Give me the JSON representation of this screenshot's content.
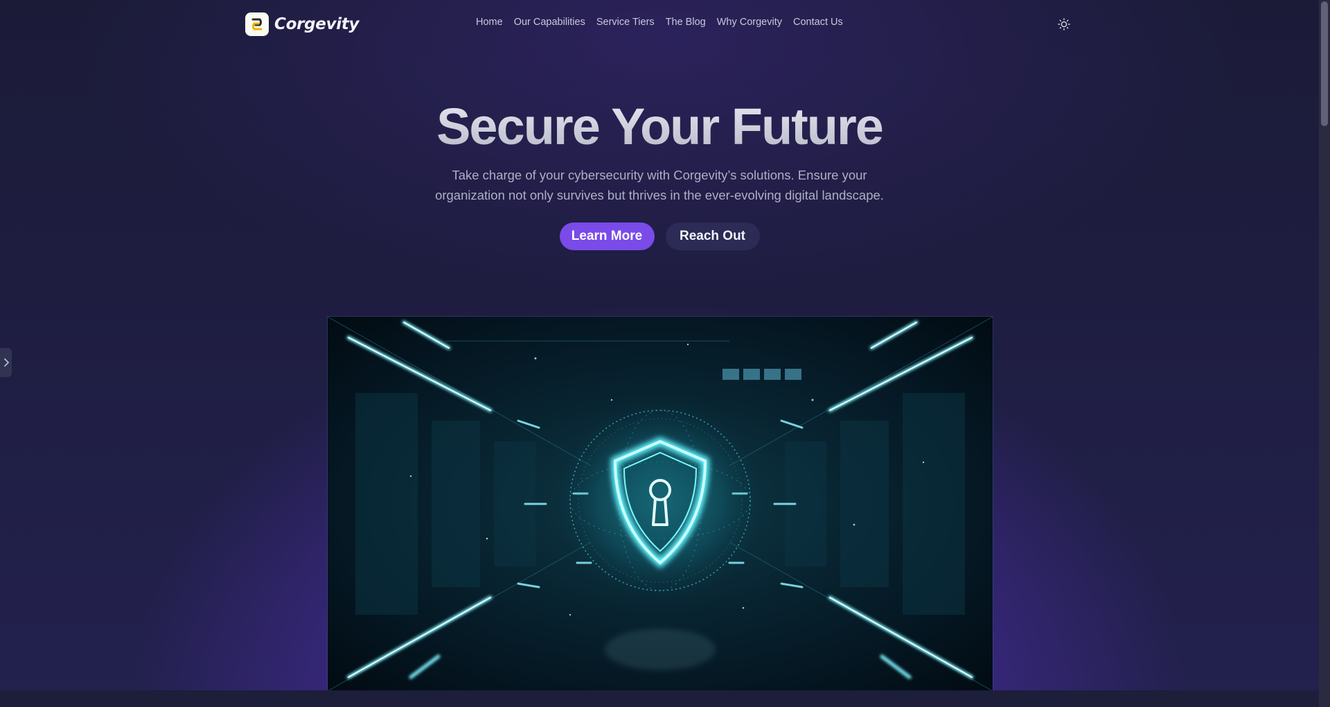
{
  "brand": {
    "name": "Corgevity",
    "logo_icon": "corgevity-logo-icon"
  },
  "nav": {
    "items": [
      {
        "label": "Home"
      },
      {
        "label": "Our Capabilities"
      },
      {
        "label": "Service Tiers"
      },
      {
        "label": "The Blog"
      },
      {
        "label": "Why Corgevity"
      },
      {
        "label": "Contact Us"
      }
    ],
    "theme_toggle_icon": "sun-icon"
  },
  "hero": {
    "title": "Secure Your Future",
    "subtitle": "Take charge of your cybersecurity with Corgevity’s solutions. Ensure your organization not only survives but thrives in the ever-evolving digital landscape.",
    "primary_cta": "Learn More",
    "secondary_cta": "Reach Out",
    "image_icon": "security-shield-lock-image"
  },
  "side_tab": {
    "icon": "chevron-right-icon"
  },
  "colors": {
    "background": "#1c1d38",
    "accent": "#7a4be8",
    "secondary_button": "#2b2b55",
    "glow": "#7442e8",
    "cyan": "#3fe6f0"
  }
}
